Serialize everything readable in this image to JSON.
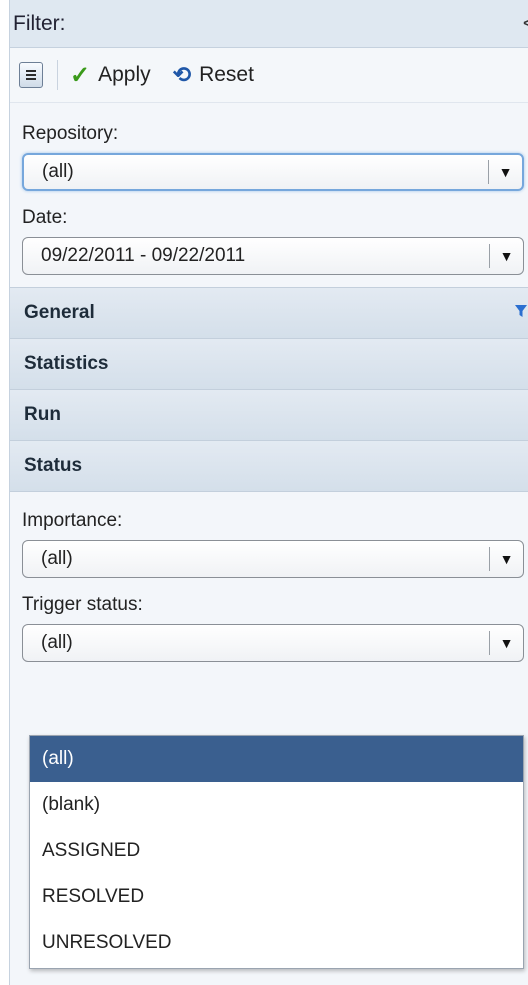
{
  "filter": {
    "title": "Filter:",
    "collapse_glyph": "<"
  },
  "toolbar": {
    "menu_icon": "list-menu-icon",
    "apply_label": "Apply",
    "reset_label": "Reset"
  },
  "fields": {
    "repository": {
      "label": "Repository:",
      "value": "(all)"
    },
    "date": {
      "label": "Date:",
      "value": "09/22/2011 - 09/22/2011"
    },
    "importance": {
      "label": "Importance:",
      "value": "(all)"
    },
    "trigger_status": {
      "label": "Trigger status:",
      "value": "(all)"
    }
  },
  "sections": {
    "general": "General",
    "statistics": "Statistics",
    "run": "Run",
    "status": "Status"
  },
  "dropdown": {
    "options": [
      "(all)",
      "(blank)",
      "ASSIGNED",
      "RESOLVED",
      "UNRESOLVED"
    ],
    "selected": "(all)"
  },
  "colors": {
    "accent": "#3a5f8f",
    "section_bg": "#d4dfea",
    "apply_check": "#3a9a1a",
    "reset_icon": "#1f57a8"
  }
}
